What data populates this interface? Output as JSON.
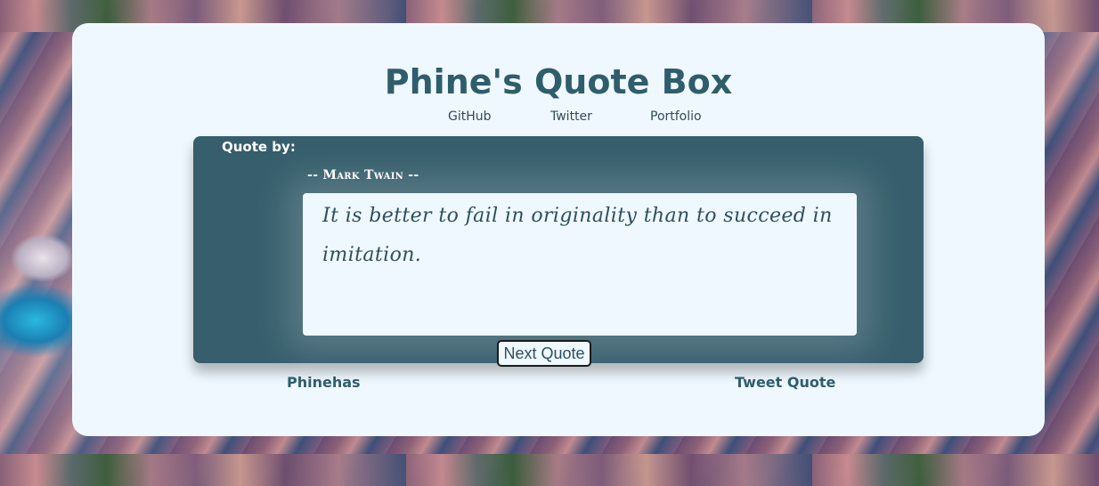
{
  "page": {
    "title": "Phine's Quote Box"
  },
  "nav": {
    "links": [
      {
        "label": "GitHub"
      },
      {
        "label": "Twitter"
      },
      {
        "label": "Portfolio"
      }
    ]
  },
  "quote": {
    "by_label": "Quote by:",
    "author": "-- Mark Twain --",
    "text": "It is better to fail in originality than to succeed in imitation.",
    "next_button": "Next Quote"
  },
  "footer": {
    "name": "Phinehas",
    "tweet_label": "Tweet Quote"
  },
  "colors": {
    "card_bg": "#eff8ff",
    "panel_bg": "#365e6c",
    "title": "#2f5d6b",
    "text": "#2e4f5e"
  }
}
